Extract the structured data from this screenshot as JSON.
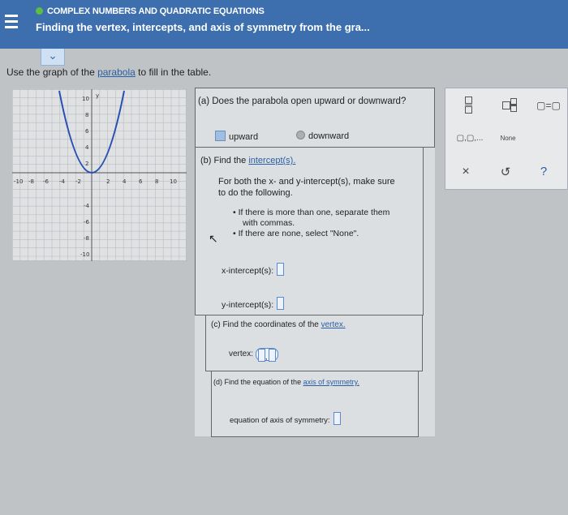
{
  "header": {
    "topic": "COMPLEX NUMBERS AND QUADRATIC EQUATIONS",
    "title": "Finding the vertex, intercepts, and axis of symmetry from the gra..."
  },
  "instruction": {
    "prefix": "Use the graph of the ",
    "link": "parabola",
    "suffix": " to fill in the table."
  },
  "graph": {
    "y_label": "y",
    "x_ticks": [
      "-10",
      "-8",
      "-6",
      "-4",
      "-2",
      "2",
      "4",
      "6",
      "8",
      "10"
    ],
    "y_ticks": [
      "10",
      "8",
      "6",
      "4",
      "2",
      "-4",
      "-6",
      "-8",
      "-10"
    ]
  },
  "part_a": {
    "question": "(a) Does the parabola open upward or downward?",
    "option_up": "upward",
    "option_down": "downward"
  },
  "part_b": {
    "heading_prefix": "(b) Find the ",
    "heading_link": "intercept(s).",
    "instr1": "For both the x- and y-intercept(s), make sure",
    "instr2": "to do the following.",
    "bullet1a": "If there is more than one, separate them",
    "bullet1b": "with commas.",
    "bullet2": "If there are none, select \"None\".",
    "x_label": "x-intercept(s):",
    "y_label": "y-intercept(s):"
  },
  "part_c": {
    "heading_prefix": "(c) Find the coordinates of the ",
    "heading_link": "vertex.",
    "vertex_label": "vertex:"
  },
  "part_d": {
    "heading_prefix": "(d) Find the equation of the ",
    "heading_link": "axis of symmetry.",
    "label": "equation of axis of symmetry:"
  },
  "toolbar": {
    "none_label": "None",
    "close_glyph": "×",
    "undo_glyph": "↺",
    "help_glyph": "?"
  }
}
